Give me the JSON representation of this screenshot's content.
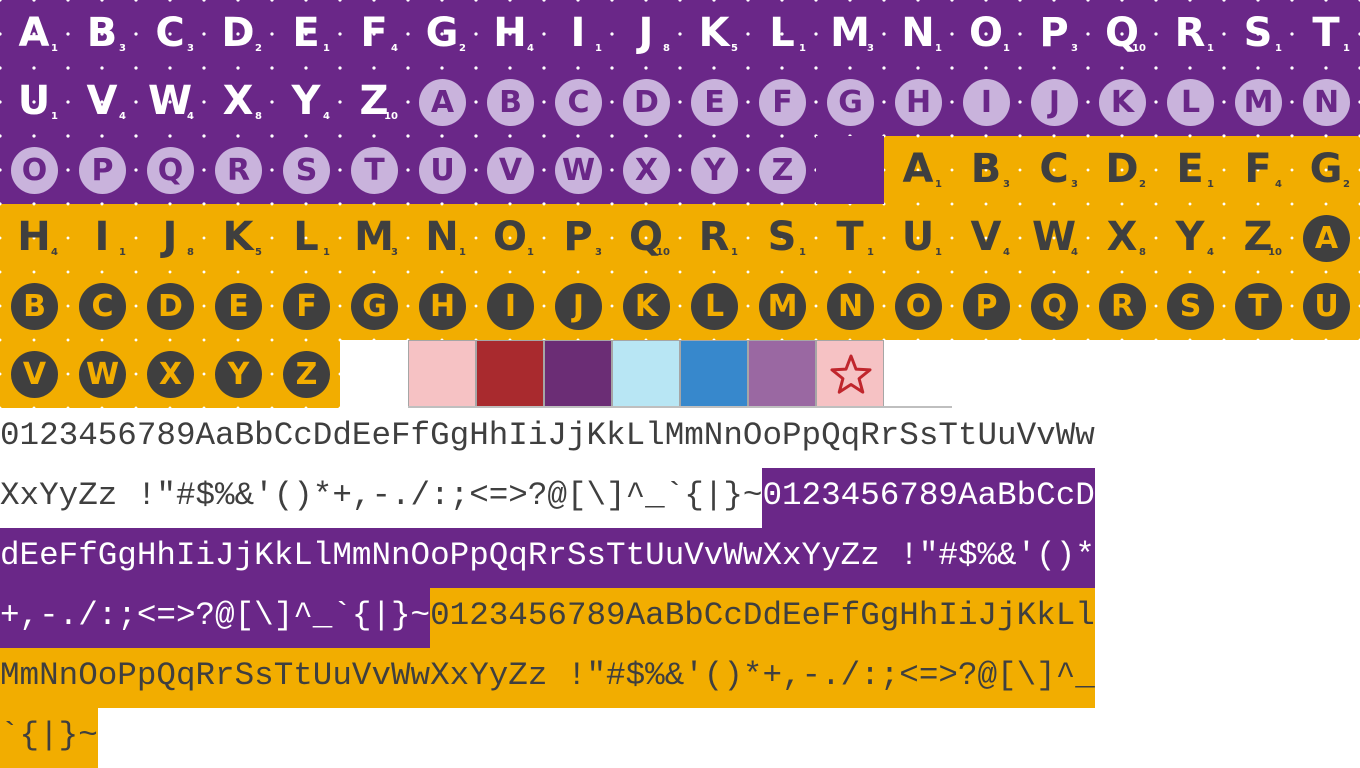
{
  "colors": {
    "purple": "#6a2788",
    "gold": "#f2ad00",
    "dark": "#3f3f3f",
    "lavender": "#c9b3dc",
    "white": "#ffffff"
  },
  "letter_tiles": {
    "letters": [
      "A",
      "B",
      "C",
      "D",
      "E",
      "F",
      "G",
      "H",
      "I",
      "J",
      "K",
      "L",
      "M",
      "N",
      "O",
      "P",
      "Q",
      "R",
      "S",
      "T",
      "U",
      "V",
      "W",
      "X",
      "Y",
      "Z"
    ],
    "points": [
      "1",
      "3",
      "3",
      "2",
      "1",
      "4",
      "2",
      "4",
      "1",
      "8",
      "5",
      "1",
      "3",
      "1",
      "1",
      "3",
      "10",
      "1",
      "1",
      "1",
      "1",
      "4",
      "4",
      "8",
      "4",
      "10"
    ]
  },
  "tile_sets": [
    {
      "name": "purple-square-tiles",
      "theme": "purple",
      "style": "square"
    },
    {
      "name": "purple-circle-tiles",
      "theme": "purple",
      "style": "circle"
    },
    {
      "name": "gold-square-tiles",
      "theme": "gold",
      "style": "square"
    },
    {
      "name": "gold-circle-tiles",
      "theme": "gold",
      "style": "circle"
    }
  ],
  "swatches": [
    {
      "name": "pink-swatch",
      "color": "#f6c2c4"
    },
    {
      "name": "red-swatch",
      "color": "#a92a2e"
    },
    {
      "name": "plum-swatch",
      "color": "#6b2d75"
    },
    {
      "name": "light-blue-swatch",
      "color": "#b8e6f4"
    },
    {
      "name": "blue-swatch",
      "color": "#3788cc"
    },
    {
      "name": "mauve-swatch",
      "color": "#9a68a2"
    },
    {
      "name": "star-swatch",
      "color": "#f6c2c4",
      "icon": "star-icon",
      "icon_color": "#c0262d"
    }
  ],
  "glyph_lines": [
    [
      {
        "theme": "white",
        "text": "0123456789AaBbCcDdEeFfGgHhIiJjKkLlMmNnOoPpQqRrSsTtUuVvWw"
      }
    ],
    [
      {
        "theme": "white",
        "text": "XxYyZz !\"#$%&'()*+,-./:;<=>?@[\\]^_`{|}~"
      },
      {
        "theme": "purple",
        "text": "0123456789AaBbCcD"
      }
    ],
    [
      {
        "theme": "purple",
        "text": "dEeFfGgHhIiJjKkLlMmNnOoPpQqRrSsTtUuVvWwXxYyZz !\"#$%&'()*"
      }
    ],
    [
      {
        "theme": "purple",
        "text": "+,-./:;<=>?@[\\]^_`{|}~"
      },
      {
        "theme": "gold",
        "text": "0123456789AaBbCcDdEeFfGgHhIiJjKkLl"
      }
    ],
    [
      {
        "theme": "gold",
        "text": "MmNnOoPpQqRrSsTtUuVvWwXxYyZz !\"#$%&'()*+,-./:;<=>?@[\\]^_"
      }
    ],
    [
      {
        "theme": "gold",
        "text": "`{|}~"
      }
    ]
  ]
}
